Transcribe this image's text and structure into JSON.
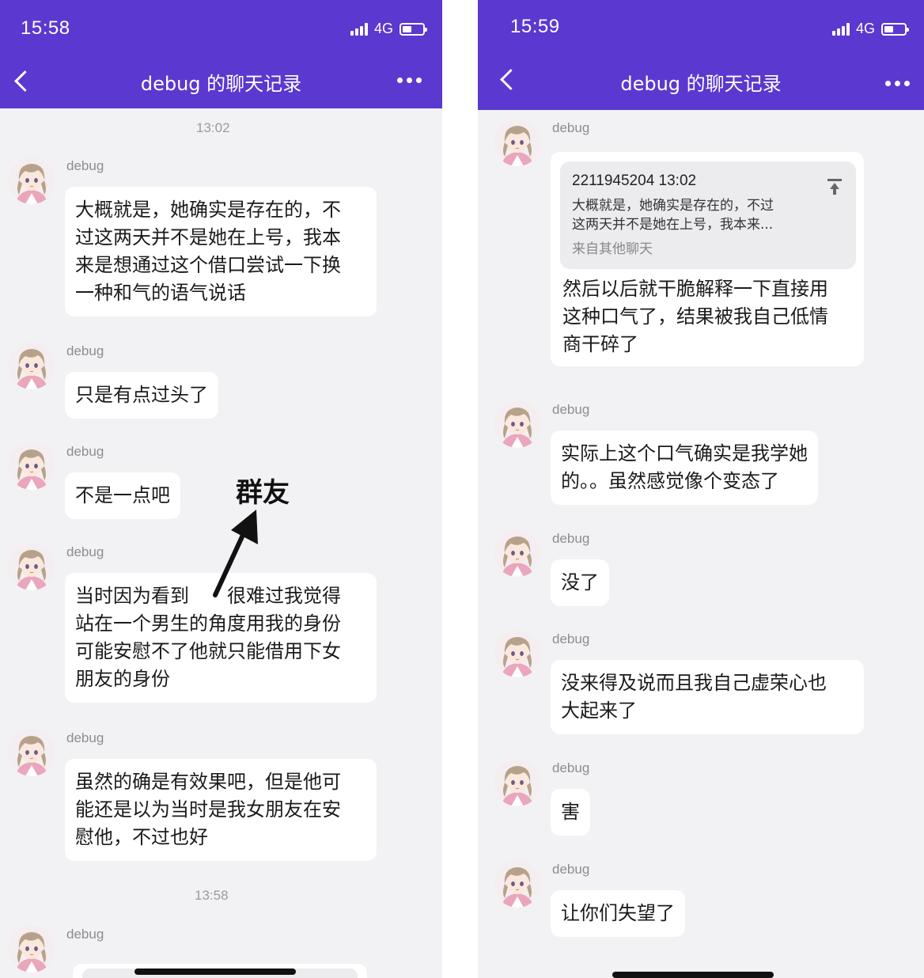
{
  "left": {
    "status": {
      "time": "15:58",
      "network": "4G"
    },
    "header": {
      "title": "debug 的聊天记录"
    },
    "timestamps": [
      "13:02",
      "13:58"
    ],
    "messages": [
      {
        "sender": "debug",
        "lines": [
          "大概就是，她确实是存在的，不",
          "过这两天并不是她在上号，我本",
          "来是想通过这个借口尝试一下换",
          "一种和气的语气说话"
        ]
      },
      {
        "sender": "debug",
        "lines": [
          "只是有点过头了"
        ]
      },
      {
        "sender": "debug",
        "lines": [
          "不是一点吧"
        ]
      },
      {
        "sender": "debug",
        "lines": [
          "当时因为看到　　很难过我觉得",
          "站在一个男生的角度用我的身份",
          "可能安慰不了他就只能借用下女",
          "朋友的身份"
        ]
      },
      {
        "sender": "debug",
        "lines": [
          "虽然的确是有效果吧，但是他可",
          "能还是以为当时是我女朋友在安",
          "慰他，不过也好"
        ]
      },
      {
        "sender": "debug"
      }
    ],
    "annotation": "群友"
  },
  "right": {
    "status": {
      "time": "15:59",
      "network": "4G"
    },
    "header": {
      "title": "debug 的聊天记录"
    },
    "messages": [
      {
        "sender": "debug",
        "quote": {
          "head": "2211945204 13:02",
          "lines": [
            "大概就是，她确实是存在的，不过",
            "这两天并不是她在上号，我本来..."
          ],
          "source": "来自其他聊天"
        },
        "lines": [
          "然后以后就干脆解释一下直接用",
          "这种口气了，结果被我自己低情",
          "商干碎了"
        ]
      },
      {
        "sender": "debug",
        "lines": [
          "实际上这个口气确实是我学她",
          "的。。虽然感觉像个变态了"
        ]
      },
      {
        "sender": "debug",
        "lines": [
          "没了"
        ]
      },
      {
        "sender": "debug",
        "lines": [
          "没来得及说而且我自己虚荣心也",
          "大起来了"
        ]
      },
      {
        "sender": "debug",
        "lines": [
          "害"
        ]
      },
      {
        "sender": "debug",
        "lines": [
          "让你们失望了"
        ]
      }
    ]
  },
  "colors": {
    "header": "#5b38cf",
    "background": "#f2f2f5",
    "bubble": "#ffffff",
    "quote": "#ececef"
  },
  "icons": [
    "back-arrow-icon",
    "more-dots-icon",
    "signal-icon",
    "battery-icon",
    "pin-top-icon"
  ]
}
